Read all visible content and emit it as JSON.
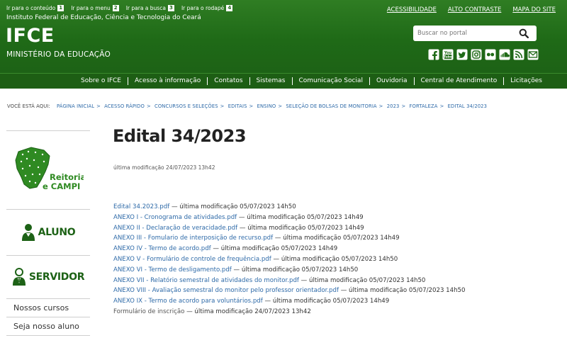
{
  "skiplinks": [
    {
      "label": "Ir para o conteúdo",
      "key": "1"
    },
    {
      "label": "Ir para o menu",
      "key": "2"
    },
    {
      "label": "Ir para a busca",
      "key": "3"
    },
    {
      "label": "Ir para o rodapé",
      "key": "4"
    }
  ],
  "header": {
    "institute": "Instituto Federal de Educação, Ciência e Tecnologia do Ceará",
    "logo": "IFCE",
    "ministry": "MINISTÉRIO DA EDUCAÇÃO",
    "toplinks": [
      "ACESSIBILIDADE",
      "ALTO CONTRASTE",
      "MAPA DO SITE"
    ],
    "search_placeholder": "Buscar no portal",
    "social_icons": [
      "facebook-icon",
      "youtube-icon",
      "twitter-icon",
      "instagram-icon",
      "flickr-icon",
      "soundcloud-icon",
      "rss-icon",
      "email-icon"
    ],
    "social_youtube_text": "You Tube"
  },
  "nav": [
    "Sobre o IFCE",
    "Acesso à informação",
    "Contatos",
    "Sistemas",
    "Comunicação Social",
    "Ouvidoria",
    "Central de Atendimento",
    "Licitações"
  ],
  "breadcrumb": {
    "label": "VOCÊ ESTÁ AQUI:",
    "items": [
      "PÁGINA INICIAL",
      "ACESSO RÁPIDO",
      "CONCURSOS E SELEÇÕES",
      "EDITAIS",
      "ENSINO",
      "SELEÇÃO DE BOLSAS DE MONITORIA",
      "2023",
      "FORTALEZA",
      "EDITAL 34/2023"
    ],
    "separator": ">"
  },
  "sidebar": {
    "reitoria_line1": "Reitoria",
    "reitoria_line2": "e CAMPI",
    "aluno": "ALUNO",
    "servidor": "SERVIDOR",
    "links": [
      "Nossos cursos",
      "Seja nosso aluno"
    ]
  },
  "main": {
    "title": "Edital 34/2023",
    "modified": "última modificação 24/07/2023 13h42",
    "files": [
      {
        "name": "Edital 34.2023.pdf",
        "meta": " — última modificação 05/07/2023 14h50",
        "link": true
      },
      {
        "name": "ANEXO I - Cronograma de atividades.pdf",
        "meta": " — última modificação 05/07/2023 14h49",
        "link": true
      },
      {
        "name": "ANEXO II - Declaração de veracidade.pdf",
        "meta": " — última modificação 05/07/2023 14h49",
        "link": true
      },
      {
        "name": "ANEXO III - Fomulario de interposição de recurso.pdf",
        "meta": " — última modificação 05/07/2023 14h49",
        "link": true
      },
      {
        "name": "ANEXO IV - Termo de acordo.pdf",
        "meta": " — última modificação 05/07/2023 14h49",
        "link": true
      },
      {
        "name": "ANEXO V - Formulário de controle de frequência.pdf",
        "meta": " — última modificação 05/07/2023 14h50",
        "link": true
      },
      {
        "name": "ANEXO VI - Termo de desligamento.pdf",
        "meta": " — última modificação 05/07/2023 14h50",
        "link": true
      },
      {
        "name": "ANEXO VII - Relatório semestral de atividades do monitor.pdf",
        "meta": " — última modificação 05/07/2023 14h50",
        "link": true
      },
      {
        "name": "ANEXO VIII - Avaliação semestral do monitor pelo professor orientador.pdf",
        "meta": " — última modificação 05/07/2023 14h50",
        "link": true
      },
      {
        "name": "ANEXO IX - Termo de acordo para voluntários.pdf",
        "meta": " — última modificação 05/07/2023 14h49",
        "link": true
      },
      {
        "name": "Formulário de inscrição",
        "meta": " — última modificação 24/07/2023 13h42",
        "link": false
      }
    ]
  },
  "colors": {
    "header_green": "#1f6a17",
    "nav_green": "#1d5e14",
    "link_blue": "#2e6aa8"
  }
}
